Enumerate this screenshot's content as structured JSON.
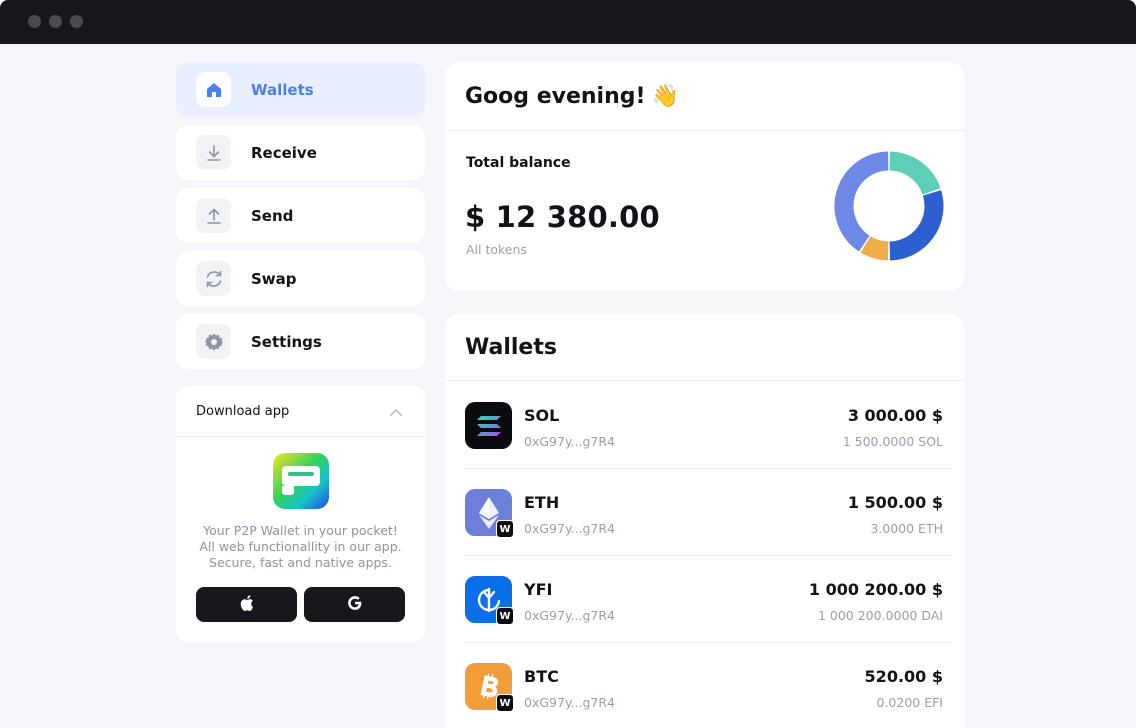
{
  "window": {
    "controls": [
      "close",
      "minimize",
      "maximize"
    ]
  },
  "sidebar": {
    "items": [
      {
        "label": "Wallets",
        "icon": "home-icon",
        "active": true
      },
      {
        "label": "Receive",
        "icon": "download-arrow-icon",
        "active": false
      },
      {
        "label": "Send",
        "icon": "upload-arrow-icon",
        "active": false
      },
      {
        "label": "Swap",
        "icon": "swap-icon",
        "active": false
      },
      {
        "label": "Settings",
        "icon": "gear-icon",
        "active": false
      }
    ],
    "download": {
      "title": "Download app",
      "line1": "Your P2P Wallet in your pocket!",
      "line2": "All web functionallity in our app.",
      "line3": "Secure, fast and native apps.",
      "buttons": [
        "apple-icon",
        "google-icon"
      ]
    }
  },
  "greeting": {
    "title": "Goog evening!",
    "emoji": "👋",
    "total_label": "Total balance",
    "total_amount": "$ 12 380.00",
    "total_sub": "All tokens",
    "donut_segments": [
      {
        "color": "#5ecfb6",
        "share": 0.2
      },
      {
        "color": "#2e5fd1",
        "share": 0.3
      },
      {
        "color": "#f0ae4a",
        "share": 0.09
      },
      {
        "color": "#6d88e6",
        "share": 0.41
      }
    ]
  },
  "wallets": {
    "title": "Wallets",
    "items": [
      {
        "symbol": "SOL",
        "address": "0xG97y...g7R4",
        "fiat": "3 000.00 $",
        "amount": "1 500.0000 SOL",
        "color": "#0c0c10",
        "badge": ""
      },
      {
        "symbol": "ETH",
        "address": "0xG97y...g7R4",
        "fiat": "1 500.00 $",
        "amount": "3.0000 ETH",
        "color": "#6c7fdb",
        "badge": "W"
      },
      {
        "symbol": "YFI",
        "address": "0xG97y...g7R4",
        "fiat": "1 000 200.00 $",
        "amount": "1 000 200.0000 DAI",
        "color": "#0a6fe8",
        "badge": "W"
      },
      {
        "symbol": "BTC",
        "address": "0xG97y...g7R4",
        "fiat": "520.00 $",
        "amount": "0.0200 EFI",
        "color": "#f09d3a",
        "badge": "W"
      }
    ]
  }
}
